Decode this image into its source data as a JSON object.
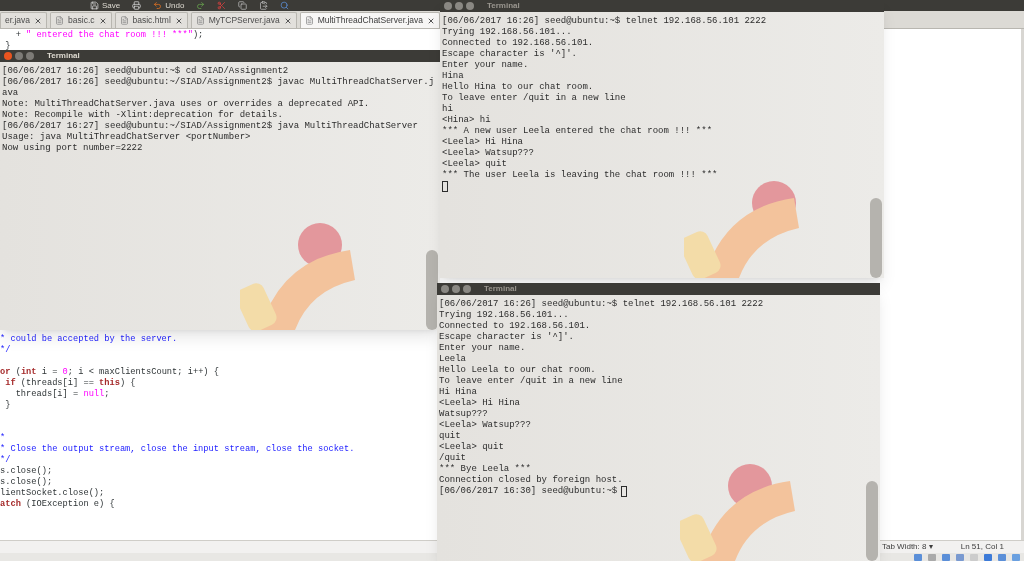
{
  "editor": {
    "toolbar": [
      {
        "label": "Save"
      },
      {
        "label": "Undo"
      }
    ],
    "tabs": [
      {
        "label": "er.java",
        "selected": false
      },
      {
        "label": "basic.c",
        "selected": false
      },
      {
        "label": "basic.html",
        "selected": false
      },
      {
        "label": "MyTCPServer.java",
        "selected": false
      },
      {
        "label": "MultiThreadChatServer.java",
        "selected": true
      }
    ],
    "code_top": [
      {
        "segments": [
          {
            "kind": "plain",
            "text": "   + "
          },
          {
            "kind": "literal",
            "text": "\" entered the chat room !!! ***\""
          },
          {
            "kind": "plain",
            "text": ");"
          }
        ]
      },
      {
        "segments": [
          {
            "kind": "plain",
            "text": " }"
          }
        ]
      }
    ],
    "code": [
      {
        "segments": [
          {
            "kind": "comment",
            "text": "* could be accepted by the server."
          }
        ]
      },
      {
        "segments": [
          {
            "kind": "comment",
            "text": "*/"
          }
        ]
      },
      {
        "kind": "blank"
      },
      {
        "segments": [
          {
            "kind": "keyword",
            "text": "or"
          },
          {
            "kind": "plain",
            "text": " ("
          },
          {
            "kind": "keyword",
            "text": "int"
          },
          {
            "kind": "plain",
            "text": " i = "
          },
          {
            "kind": "literal",
            "text": "0"
          },
          {
            "kind": "plain",
            "text": "; i < maxClientsCount; i++) {"
          }
        ]
      },
      {
        "segments": [
          {
            "kind": "keyword",
            "text": " if"
          },
          {
            "kind": "plain",
            "text": " (threads[i] == "
          },
          {
            "kind": "keyword",
            "text": "this"
          },
          {
            "kind": "plain",
            "text": ") {"
          }
        ]
      },
      {
        "segments": [
          {
            "kind": "plain",
            "text": "   threads[i] = "
          },
          {
            "kind": "literal",
            "text": "null"
          },
          {
            "kind": "plain",
            "text": ";"
          }
        ]
      },
      {
        "segments": [
          {
            "kind": "plain",
            "text": " }"
          }
        ]
      },
      {
        "kind": "blank"
      },
      {
        "kind": "blank"
      },
      {
        "segments": [
          {
            "kind": "comment",
            "text": "*"
          }
        ]
      },
      {
        "segments": [
          {
            "kind": "comment",
            "text": "* Close the output stream, close the input stream, close the socket."
          }
        ]
      },
      {
        "segments": [
          {
            "kind": "comment",
            "text": "*/"
          }
        ]
      },
      {
        "segments": [
          {
            "kind": "plain",
            "text": "s.close();"
          }
        ]
      },
      {
        "segments": [
          {
            "kind": "plain",
            "text": "s.close();"
          }
        ]
      },
      {
        "segments": [
          {
            "kind": "plain",
            "text": "lientSocket.close();"
          }
        ]
      },
      {
        "segments": [
          {
            "kind": "keyword",
            "text": "atch"
          },
          {
            "kind": "plain",
            "text": " (IOException e) {"
          }
        ]
      }
    ],
    "status_bar": {
      "tab_width": "Tab Width: 8",
      "caret": "▾",
      "position": "Ln 51, Col 1"
    }
  },
  "terminals": [
    {
      "kind": "busy",
      "title": "Terminal",
      "focused": true,
      "lines": [
        "[06/06/2017 16:26] seed@ubuntu:~$ cd SIAD/Assignment2",
        "[06/06/2017 16:26] seed@ubuntu:~/SIAD/Assignment2$ javac MultiThreadChatServer.j",
        "ava",
        "Note: MultiThreadChatServer.java uses or overrides a deprecated API.",
        "Note: Recompile with -Xlint:deprecation for details.",
        "[06/06/2017 16:27] seed@ubuntu:~/SIAD/Assignment2$ java MultiThreadChatServer",
        "Usage: java MultiThreadChatServer <portNumber>",
        "Now using port number=2222"
      ]
    },
    {
      "kind": "waiting",
      "title": "Terminal",
      "focused": false,
      "lines": [
        "[06/06/2017 16:26] seed@ubuntu:~$ telnet 192.168.56.101 2222",
        "Trying 192.168.56.101...",
        "Connected to 192.168.56.101.",
        "Escape character is '^]'.",
        "Enter your name.",
        "Hina",
        "Hello Hina to our chat room.",
        "To leave enter /quit in a new line",
        "hi",
        "<Hina> hi",
        "*** A new user Leela entered the chat room !!! ***",
        "<Leela> Hi Hina",
        "<Leela> Watsup???",
        "<Leela> quit",
        "*** The user Leela is leaving the chat room !!! ***"
      ]
    },
    {
      "kind": "prompt",
      "title": "Terminal",
      "focused": false,
      "lines": [
        "[06/06/2017 16:26] seed@ubuntu:~$ telnet 192.168.56.101 2222",
        "Trying 192.168.56.101...",
        "Connected to 192.168.56.101.",
        "Escape character is '^]'.",
        "Enter your name.",
        "Leela",
        "Hello Leela to our chat room.",
        "To leave enter /quit in a new line",
        "Hi Hina",
        "<Leela> Hi Hina",
        "Watsup???",
        "<Leela> Watsup???",
        "quit",
        "<Leela> quit",
        "/quit",
        "*** Bye Leela ***",
        "Connection closed by foreign host.",
        "[06/06/2017 16:30] seed@ubuntu:~$"
      ]
    }
  ]
}
